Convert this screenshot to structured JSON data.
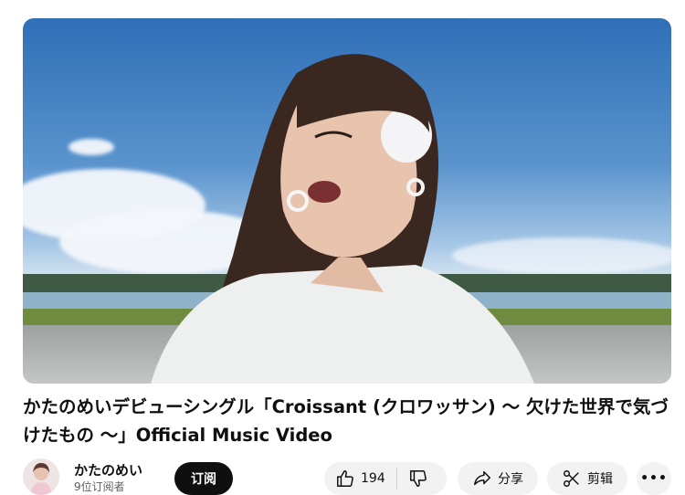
{
  "video": {
    "title": "かたのめいデビューシングル「Croissant (クロワッサン) 〜 欠けた世界で気づけたもの 〜」Official Music Video"
  },
  "channel": {
    "name": "かたのめい",
    "subscribers": "9位订阅者",
    "subscribe_label": "订阅"
  },
  "actions": {
    "like_count": "194",
    "share_label": "分享",
    "clip_label": "剪辑",
    "more_label": "•••"
  }
}
